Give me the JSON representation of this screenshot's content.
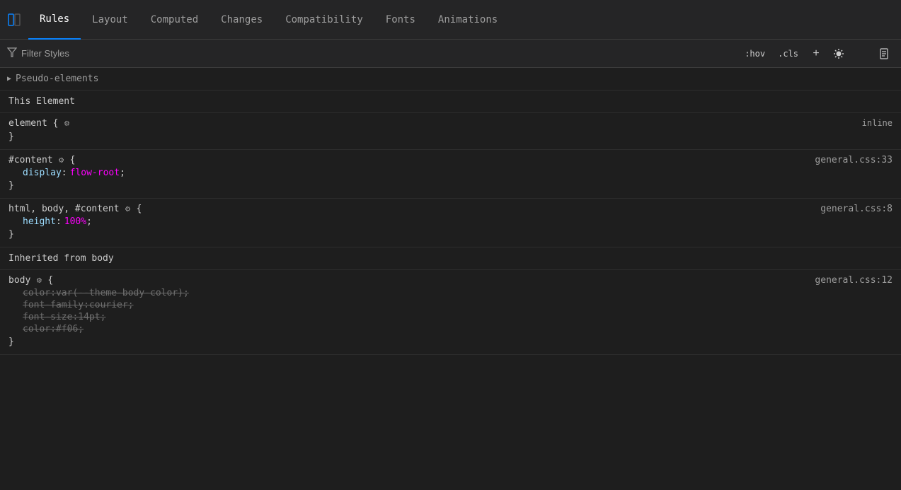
{
  "tabs": [
    {
      "id": "rules",
      "label": "Rules",
      "active": true
    },
    {
      "id": "layout",
      "label": "Layout",
      "active": false
    },
    {
      "id": "computed",
      "label": "Computed",
      "active": false
    },
    {
      "id": "changes",
      "label": "Changes",
      "active": false
    },
    {
      "id": "compatibility",
      "label": "Compatibility",
      "active": false
    },
    {
      "id": "fonts",
      "label": "Fonts",
      "active": false
    },
    {
      "id": "animations",
      "label": "Animations",
      "active": false
    }
  ],
  "toolbar": {
    "filter_placeholder": "Filter Styles",
    "hov_button": ":hov",
    "cls_button": ".cls",
    "add_label": "+",
    "light_icon": "☀",
    "dark_icon": "◗",
    "doc_icon": "🗋"
  },
  "pseudo_elements": {
    "label": "Pseudo-elements",
    "expanded": false
  },
  "sections": [
    {
      "id": "this-element",
      "label": "This Element",
      "rules": [
        {
          "id": "element-inline",
          "selector": "element {",
          "has_gear": true,
          "source": "inline",
          "properties": [],
          "close": "}"
        },
        {
          "id": "content-rule",
          "selector": "#content",
          "has_gear": true,
          "selector_suffix": " {",
          "source": "general.css:33",
          "properties": [
            {
              "name": "display",
              "colon": ":",
              "value": "flow-root",
              "semicolon": ";",
              "strikethrough": false,
              "value_color": "magenta"
            }
          ],
          "close": "}"
        },
        {
          "id": "html-body-rule",
          "selector": "html, body, #content",
          "has_gear": true,
          "selector_suffix": " {",
          "source": "general.css:8",
          "properties": [
            {
              "name": "height",
              "colon": ":",
              "value": "100%",
              "semicolon": ";",
              "strikethrough": false,
              "value_color": "magenta"
            }
          ],
          "close": "}"
        }
      ]
    },
    {
      "id": "inherited-from-body",
      "label": "Inherited from body",
      "rules": [
        {
          "id": "body-rule",
          "selector": "body",
          "has_gear": true,
          "selector_suffix": " {",
          "source": "general.css:12",
          "properties": [
            {
              "name": "color",
              "colon": ":",
              "value": "var(--theme-body-color)",
              "semicolon": ";",
              "strikethrough": true,
              "value_color": "strike"
            },
            {
              "name": "font-family",
              "colon": ":",
              "value": "courier",
              "semicolon": ";",
              "strikethrough": true,
              "value_color": "strike"
            },
            {
              "name": "font-size",
              "colon": ":",
              "value": "14pt",
              "semicolon": ";",
              "strikethrough": true,
              "value_color": "strike"
            },
            {
              "name": "color",
              "colon": ":",
              "value": "#f06",
              "semicolon": ";",
              "strikethrough": true,
              "value_color": "strike"
            }
          ],
          "close": "}"
        }
      ]
    }
  ]
}
